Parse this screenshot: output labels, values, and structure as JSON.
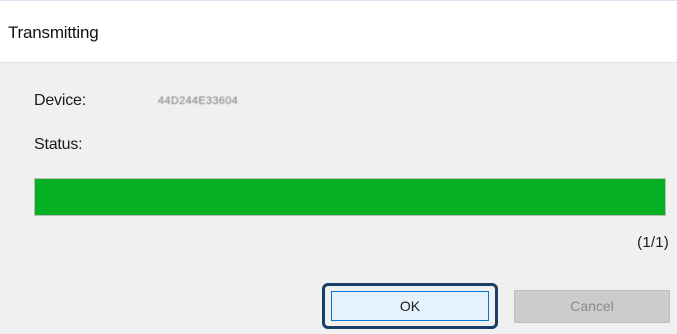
{
  "window": {
    "title": "Transmitting"
  },
  "fields": {
    "device_label": "Device:",
    "device_value": "44D244E33604",
    "status_label": "Status:"
  },
  "progress": {
    "fraction": 1.0,
    "counter_text": "(1/1)",
    "fill_color": "#06b025"
  },
  "buttons": {
    "ok_label": "OK",
    "cancel_label": "Cancel",
    "cancel_enabled": false
  },
  "colors": {
    "focus_ring": "#173f66",
    "ok_border": "#0078d7",
    "body_background": "#f0f0f0"
  }
}
